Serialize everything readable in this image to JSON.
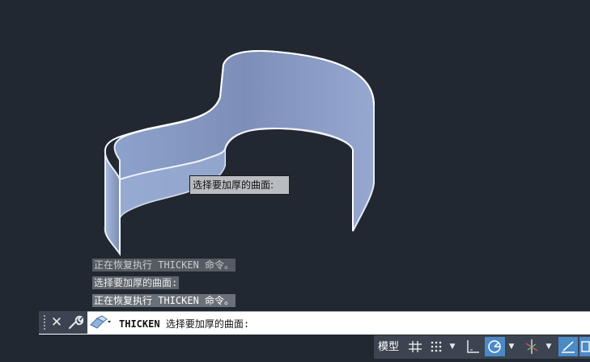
{
  "viewport": {
    "tooltip": "选择要加厚的曲面:"
  },
  "history": [
    "正在恢复执行 THICKEN 命令。",
    "选择要加厚的曲面:",
    "正在恢复执行 THICKEN 命令。"
  ],
  "command_line": {
    "command": "THICKEN",
    "prompt": "选择要加厚的曲面:"
  },
  "status_bar": {
    "model_label": "模型"
  },
  "icons": {
    "close": "close-icon",
    "customize": "wrench-icon",
    "recent_commands": "eraser-icon",
    "grid": "grid-icon",
    "snap": "snap-dots-icon",
    "ortho": "ortho-icon",
    "polar": "polar-tracking-icon",
    "isodraft": "isometric-icon",
    "osnap_track": "tracking-icon"
  },
  "colors": {
    "background": "#222831",
    "surface": "#8d9fc6",
    "accent": "#4b8ac6"
  }
}
